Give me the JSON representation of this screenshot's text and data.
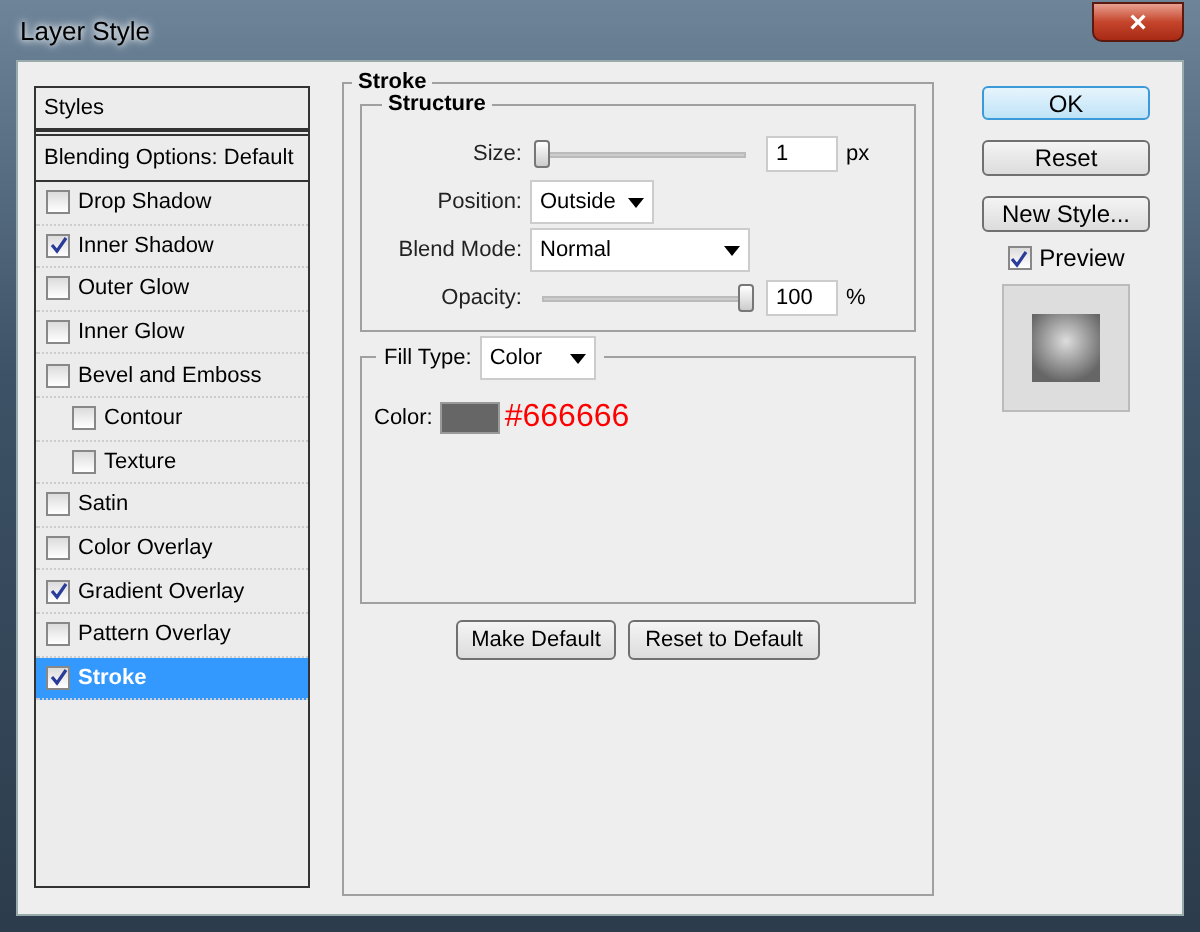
{
  "window": {
    "title": "Layer Style",
    "close": "×"
  },
  "styles_panel": {
    "header": "Styles",
    "blending": "Blending Options: Default",
    "items": [
      {
        "label": "Drop Shadow",
        "checked": false,
        "selected": false
      },
      {
        "label": "Inner Shadow",
        "checked": true,
        "selected": false
      },
      {
        "label": "Outer Glow",
        "checked": false,
        "selected": false
      },
      {
        "label": "Inner Glow",
        "checked": false,
        "selected": false
      },
      {
        "label": "Bevel and Emboss",
        "checked": false,
        "selected": false,
        "children": [
          {
            "label": "Contour",
            "checked": false,
            "selected": false
          },
          {
            "label": "Texture",
            "checked": false,
            "selected": false
          }
        ]
      },
      {
        "label": "Satin",
        "checked": false,
        "selected": false
      },
      {
        "label": "Color Overlay",
        "checked": false,
        "selected": false
      },
      {
        "label": "Gradient Overlay",
        "checked": true,
        "selected": false
      },
      {
        "label": "Pattern Overlay",
        "checked": false,
        "selected": false
      },
      {
        "label": "Stroke",
        "checked": true,
        "selected": true
      }
    ]
  },
  "stroke": {
    "title": "Stroke",
    "structure_title": "Structure",
    "size": {
      "label": "Size:",
      "level": 0,
      "value": "1",
      "unit": "px"
    },
    "position": {
      "label": "Position:",
      "value": "Outside"
    },
    "blend_mode": {
      "label": "Blend Mode:",
      "value": "Normal"
    },
    "opacity": {
      "label": "Opacity:",
      "level": 1,
      "value": "100",
      "unit": "%"
    },
    "fill_type": {
      "label": "Fill Type:",
      "value": "Color"
    },
    "color": {
      "label": "Color:",
      "color": "#666666",
      "hex": "#666666"
    },
    "buttons": [
      "Make Default",
      "Reset to Default"
    ]
  },
  "actions": {
    "ok": "OK",
    "reset": "Reset",
    "new_style": "New Style...",
    "preview": {
      "label": "Preview",
      "checked": true
    }
  }
}
